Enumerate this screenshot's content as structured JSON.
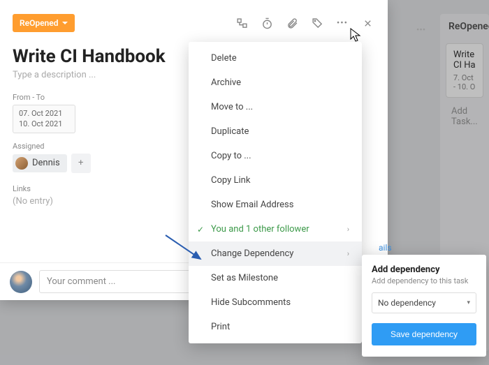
{
  "status_label": "ReOpened",
  "title": "Write CI Handbook",
  "description_placeholder": "Type a description ...",
  "dates": {
    "label": "From - To",
    "from": "07. Oct 2021",
    "to": "10. Oct 2021"
  },
  "assigned": {
    "label": "Assigned",
    "user": "Dennis",
    "add_symbol": "+"
  },
  "links": {
    "label": "Links",
    "value": "(No entry)"
  },
  "comment_placeholder": "Your comment ...",
  "menu": {
    "delete": "Delete",
    "archive": "Archive",
    "move_to": "Move to ...",
    "duplicate": "Duplicate",
    "copy_to": "Copy to ...",
    "copy_link": "Copy Link",
    "show_email": "Show Email Address",
    "followers": "You and 1 other follower",
    "change_dep": "Change Dependency",
    "milestone": "Set as Milestone",
    "hide_sub": "Hide Subcomments",
    "print": "Print",
    "arrow": "›"
  },
  "dependency": {
    "title": "Add dependency",
    "subtitle": "Add dependency to this task",
    "selected": "No dependency",
    "save": "Save dependency"
  },
  "details_link": "ails",
  "bg_column": {
    "header": "ReOpened(",
    "card_title": "Write CI Ha",
    "card_dates": "7. Oct - 10. O",
    "add": "Add Task...",
    "more": "•••"
  }
}
